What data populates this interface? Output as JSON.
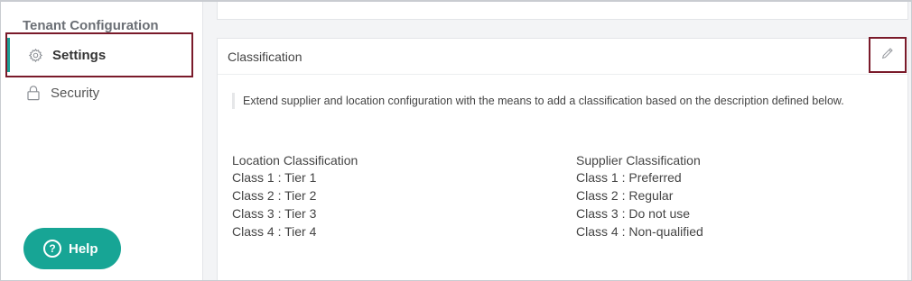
{
  "sidebar": {
    "heading": "Tenant Configuration",
    "items": [
      {
        "label": "Settings",
        "icon": "gear-icon",
        "active": true
      },
      {
        "label": "Security",
        "icon": "lock-icon",
        "active": false
      }
    ]
  },
  "help": {
    "label": "Help",
    "icon": "question-circle-icon",
    "color": "#17a595"
  },
  "card": {
    "title": "Classification",
    "edit_icon": "pencil-icon",
    "description": "Extend supplier and location configuration with the means to add a classification based on the description defined below.",
    "location": {
      "title": "Location Classification",
      "items": [
        "Class 1 : Tier 1",
        "Class 2 : Tier 2",
        "Class 3 : Tier 3",
        "Class 4 : Tier 4"
      ]
    },
    "supplier": {
      "title": "Supplier Classification",
      "items": [
        "Class 1 : Preferred",
        "Class 2 : Regular",
        "Class 3 : Do not use",
        "Class 4 : Non-qualified"
      ]
    }
  },
  "colors": {
    "accent": "#1a9e95",
    "highlight_border": "#7a1a2a"
  }
}
